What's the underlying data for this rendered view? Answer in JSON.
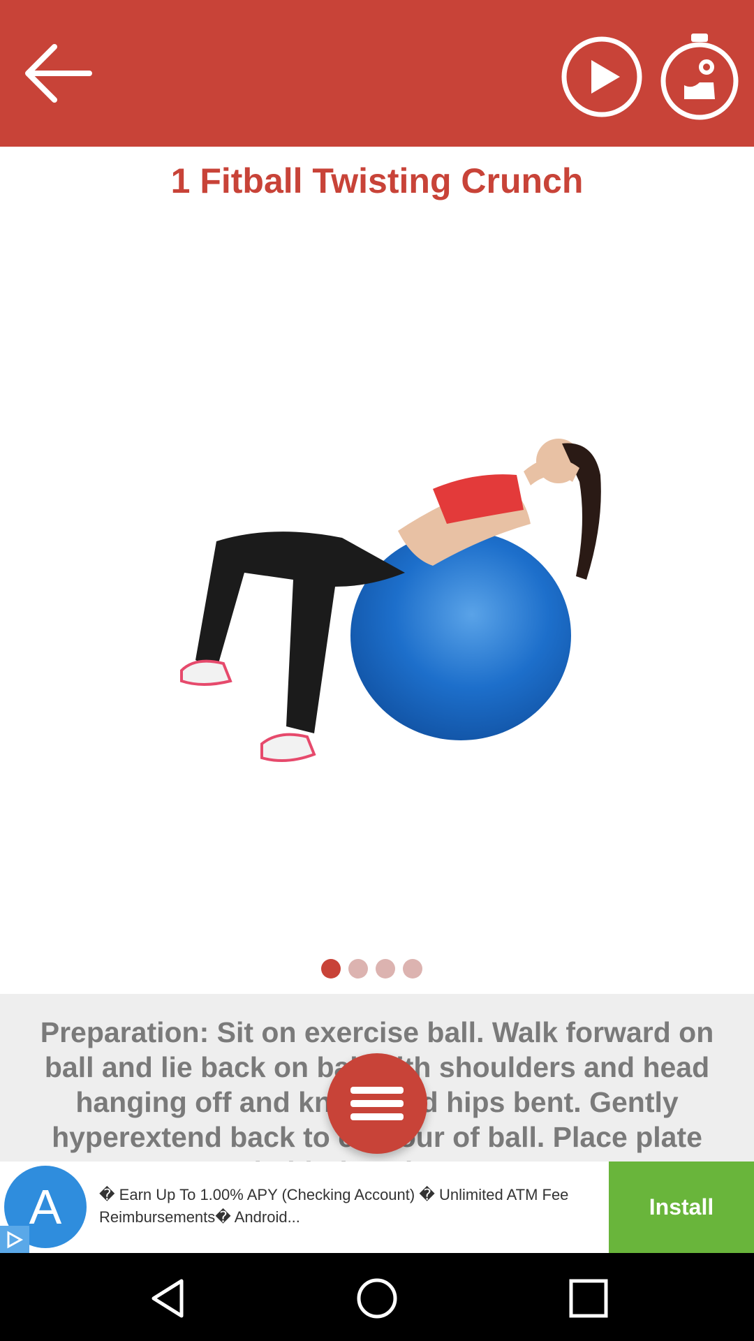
{
  "app": {
    "title": "1 Fitball Twisting Crunch"
  },
  "toolbar": {
    "back_icon": "arrow-left-icon",
    "play_icon": "play-icon",
    "timer_icon": "timer-muscle-icon"
  },
  "carousel": {
    "image_label": "woman doing fitball twisting crunch",
    "pages": 4,
    "active_page": 1
  },
  "description": {
    "text": "Preparation: Sit on exercise ball. Walk forward on ball and lie back on ball with shoulders and head hanging off and knees and hips bent. Gently hyperextend back to contour of ball. Place plate behind neck or on"
  },
  "menu": {
    "icon": "menu-icon"
  },
  "ad": {
    "text": "� Earn Up To 1.00% APY (Checking Account) � Unlimited ATM Fee Reimbursements� Android...",
    "install_label": "Install",
    "logo_letter": "A"
  },
  "navigation": {
    "back_icon": "nav-back-icon",
    "home_icon": "nav-home-icon",
    "recents_icon": "nav-recents-icon"
  },
  "colors": {
    "primary": "#c84338",
    "install": "#69b53b",
    "ad_logo": "#2f8ddd"
  }
}
